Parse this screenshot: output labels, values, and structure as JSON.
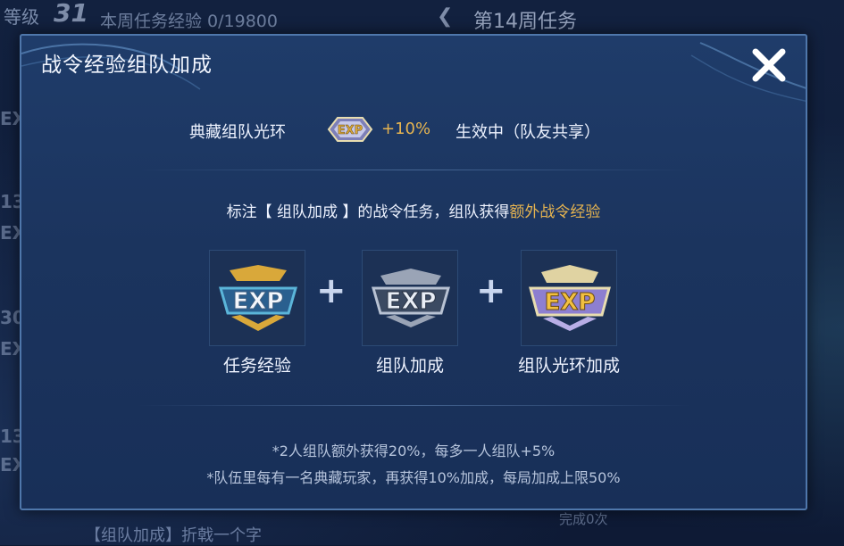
{
  "background": {
    "level_prefix": "等级",
    "level_number": "31",
    "weekly_exp_label": "本周任务经验 0/19800",
    "week_title": "第14周任务",
    "side_exp_labels": [
      "EX",
      "13",
      "EX",
      "30",
      "EX",
      "13",
      "EX"
    ],
    "bottom_task_text": "【组队加成】折戟一个字",
    "bottom_count": "完成0次"
  },
  "modal": {
    "title": "战令经验组队加成",
    "aura": {
      "label": "典藏组队光环",
      "badge_text": "EXP",
      "percent": "+10%",
      "status": "生效中（队友共享）"
    },
    "note": {
      "prefix": "标注【 组队加成 】的战令任务，组队获得",
      "highlight": "额外战令经验"
    },
    "cards": [
      {
        "label": "任务经验",
        "icon": "exp-gold-badge-icon",
        "badge_text": "EXP"
      },
      {
        "label": "组队加成",
        "icon": "exp-silver-badge-icon",
        "badge_text": "EXP"
      },
      {
        "label": "组队光环加成",
        "icon": "exp-crystal-badge-icon",
        "badge_text": "EXP"
      }
    ],
    "plus_symbol": "+",
    "rules": [
      "*2人组队额外获得20%，每多一人组队+5%",
      "*队伍里每有一名典藏玩家，再获得10%加成，每局加成上限50%"
    ]
  },
  "colors": {
    "accent_gold": "#e6b450",
    "modal_bg": "#1d385f",
    "modal_border": "#4f77ab"
  }
}
